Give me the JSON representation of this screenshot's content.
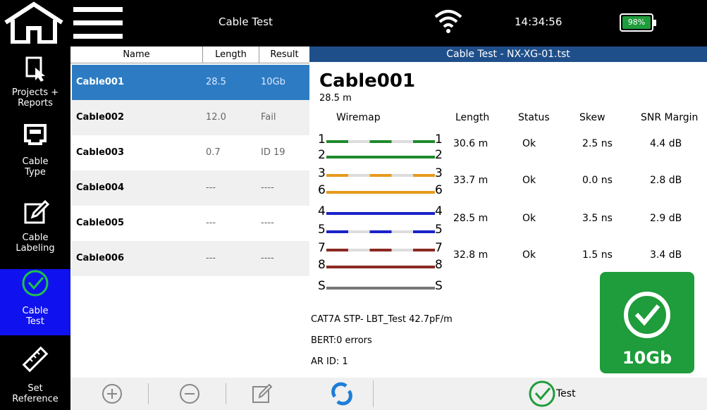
{
  "topbar": {
    "title": "Cable Test",
    "clock": "14:34:56",
    "battery": "98%",
    "battery_color": "#1f9c3b"
  },
  "sidebar": {
    "items": [
      {
        "label": "Projects +\nReports",
        "icon": "folder-report-icon",
        "active": false
      },
      {
        "label": "Cable\nType",
        "icon": "ethernet-port-icon",
        "active": false
      },
      {
        "label": "Cable\nLabeling",
        "icon": "edit-icon",
        "active": false
      },
      {
        "label": "Cable\nTest",
        "icon": "check-circle-icon",
        "active": true
      },
      {
        "label": "Set\nReference",
        "icon": "ruler-icon",
        "active": false
      }
    ],
    "active_color": "#0f12ee"
  },
  "list": {
    "headers": {
      "name": "Name",
      "length": "Length",
      "result": "Result"
    },
    "rows": [
      {
        "name": "Cable001",
        "length": "28.5",
        "result": "10Gb"
      },
      {
        "name": "Cable002",
        "length": "12.0",
        "result": "Fail"
      },
      {
        "name": "Cable003",
        "length": "0.7",
        "result": "ID 19"
      },
      {
        "name": "Cable004",
        "length": "---",
        "result": "----"
      },
      {
        "name": "Cable005",
        "length": "---",
        "result": "----"
      },
      {
        "name": "Cable006",
        "length": "---",
        "result": "----"
      }
    ],
    "selected_color": "#2d7cc3"
  },
  "detail": {
    "header": "Cable Test - NX-XG-01.tst",
    "cable_name": "Cable001",
    "cable_length": "28.5 m",
    "columns": {
      "wiremap": "Wiremap",
      "length": "Length",
      "status": "Status",
      "skew": "Skew",
      "snr": "SNR Margin"
    },
    "pairs": [
      {
        "length": "30.6 m",
        "status": "Ok",
        "skew": "2.5 ns",
        "snr": "4.4 dB"
      },
      {
        "length": "33.7 m",
        "status": "Ok",
        "skew": "0.0 ns",
        "snr": "2.8 dB"
      },
      {
        "length": "28.5 m",
        "status": "Ok",
        "skew": "3.5 ns",
        "snr": "2.9 dB"
      },
      {
        "length": "32.8 m",
        "status": "Ok",
        "skew": "1.5 ns",
        "snr": "3.4 dB"
      }
    ],
    "wire_labels": [
      {
        "left": "1",
        "right": "1"
      },
      {
        "left": "2",
        "right": "2"
      },
      {
        "left": "3",
        "right": "3"
      },
      {
        "left": "6",
        "right": "6"
      },
      {
        "left": "4",
        "right": "4"
      },
      {
        "left": "5",
        "right": "5"
      },
      {
        "left": "7",
        "right": "7"
      },
      {
        "left": "8",
        "right": "8"
      },
      {
        "left": "S",
        "right": "S"
      }
    ],
    "cable_type": "CAT7A STP- LBT_Test  42.7pF/m",
    "bert": "BERT:0 errors",
    "ar_id": "AR ID: 1",
    "result": "10Gb",
    "result_color": "#1f9c3b"
  },
  "bottom": {
    "test_label": "Test"
  }
}
